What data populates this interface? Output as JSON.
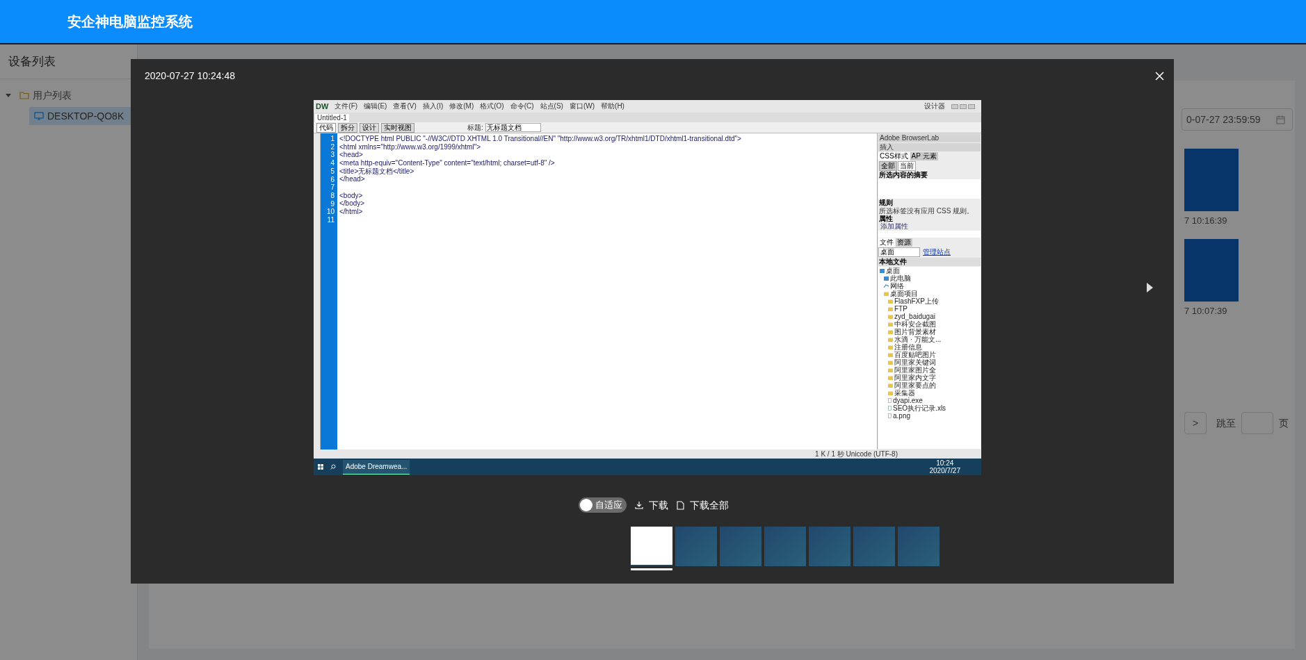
{
  "header": {
    "title": "安企神电脑监控系统"
  },
  "sidebar": {
    "title": "设备列表",
    "tree": [
      {
        "label": "用户列表",
        "expanded": true,
        "children": [
          {
            "label": "DESKTOP-QO8K",
            "selected": true
          }
        ]
      }
    ]
  },
  "main": {
    "date_field": {
      "value": "0-07-27 23:59:59"
    },
    "screenshots": [
      {
        "time": "7 10:16:39"
      },
      {
        "time": "7 10:07:39"
      }
    ],
    "pagination": {
      "next": ">",
      "jump_label": "跳至",
      "page_suffix": "页"
    }
  },
  "viewer": {
    "timestamp": "2020-07-27 10:24:48",
    "capture": {
      "app_logo": "DW",
      "menu": [
        "文件(F)",
        "编辑(E)",
        "查看(V)",
        "插入(I)",
        "修改(M)",
        "格式(O)",
        "命令(C)",
        "站点(S)",
        "窗口(W)",
        "帮助(H)"
      ],
      "layout_label": "设计器",
      "doc_tab": "Untitled-1",
      "view_buttons": [
        {
          "label": "代码",
          "selected": true
        },
        {
          "label": "拆分",
          "selected": false
        },
        {
          "label": "设计",
          "selected": false
        },
        {
          "label": "实时视图",
          "selected": false
        }
      ],
      "title_label": "标题:",
      "title_value": "无标题文档",
      "panel": {
        "top_items": [
          "Adobe BrowserLab",
          "插入"
        ],
        "css_tabs": [
          {
            "label": "CSS样式",
            "selected": true
          },
          {
            "label": "AP 元素",
            "selected": false
          }
        ],
        "mode_tabs": [
          {
            "label": "全部",
            "selected": false
          },
          {
            "label": "当前",
            "selected": true
          }
        ],
        "summary_title": "所选内容的摘要",
        "rules_title": "规则",
        "rules_text": "所选标签没有应用 CSS 规则。",
        "props_title": "属性",
        "props_link": "添加属性",
        "file_tabs": [
          {
            "label": "文件",
            "selected": true
          },
          {
            "label": "资源",
            "selected": false
          }
        ],
        "site_select": "桌面",
        "manage_link": "管理站点",
        "files_header": "本地文件",
        "files": [
          {
            "label": "桌面",
            "kind": "desktop",
            "children": [
              {
                "label": "此电脑",
                "kind": "computer"
              },
              {
                "label": "网络",
                "kind": "network"
              },
              {
                "label": "桌面项目",
                "kind": "folder",
                "children": [
                  {
                    "label": "FlashFXP上传",
                    "kind": "folder"
                  },
                  {
                    "label": "FTP",
                    "kind": "folder"
                  },
                  {
                    "label": "zyd_baidugai",
                    "kind": "folder"
                  },
                  {
                    "label": "中科安企截图",
                    "kind": "folder"
                  },
                  {
                    "label": "图片背景素材",
                    "kind": "folder"
                  },
                  {
                    "label": "水滴 · 万能文...",
                    "kind": "folder"
                  },
                  {
                    "label": "注册信息",
                    "kind": "folder"
                  },
                  {
                    "label": "百度贴吧图片",
                    "kind": "folder"
                  },
                  {
                    "label": "阿里家关键词",
                    "kind": "folder"
                  },
                  {
                    "label": "阿里家图片全",
                    "kind": "folder"
                  },
                  {
                    "label": "阿里家内文字",
                    "kind": "folder"
                  },
                  {
                    "label": "阿里家要点的",
                    "kind": "folder"
                  },
                  {
                    "label": "采集器",
                    "kind": "folder"
                  },
                  {
                    "label": "dyapi.exe",
                    "kind": "file"
                  },
                  {
                    "label": "SEO执行记录.xls",
                    "kind": "file"
                  },
                  {
                    "label": "a.png",
                    "kind": "file"
                  }
                ]
              }
            ]
          }
        ]
      },
      "status": "1 K / 1 秒 Unicode (UTF-8)",
      "taskbar": {
        "app": "Adobe Dreamwea...",
        "time": "10:24",
        "date": "2020/7/27"
      },
      "code_lines": [
        {
          "number": "1",
          "text": "<!DOCTYPE html PUBLIC \"-//W3C//DTD XHTML 1.0 Transitional//EN\" \"http://www.w3.org/TR/xhtml1/DTD/xhtml1-transitional.dtd\">"
        },
        {
          "number": "2",
          "text": "<html xmlns=\"http://www.w3.org/1999/xhtml\">"
        },
        {
          "number": "3",
          "text": "<head>"
        },
        {
          "number": "4",
          "text": "<meta http-equiv=\"Content-Type\" content=\"text/html; charset=utf-8\" />"
        },
        {
          "number": "5",
          "text": "<title>无标题文档</title>"
        },
        {
          "number": "6",
          "text": "</head>"
        },
        {
          "number": "7"
        },
        {
          "number": "8",
          "text": "<body>"
        },
        {
          "number": "9",
          "text": "</body>"
        },
        {
          "number": "10",
          "text": "</html>"
        },
        {
          "number": "11"
        }
      ]
    },
    "fit_toggle": {
      "label": "自适应",
      "on": false
    },
    "actions": [
      {
        "label": "下载",
        "kind": "download"
      },
      {
        "label": "下载全部",
        "kind": "download_all"
      }
    ],
    "thumbnails": [
      {
        "kind": "editor",
        "selected": true
      },
      {
        "kind": "desktop",
        "selected": false
      },
      {
        "kind": "desktop",
        "selected": false
      },
      {
        "kind": "desktop",
        "selected": false
      },
      {
        "kind": "desktop",
        "selected": false
      },
      {
        "kind": "desktop",
        "selected": false
      },
      {
        "kind": "desktop",
        "selected": false
      }
    ]
  }
}
